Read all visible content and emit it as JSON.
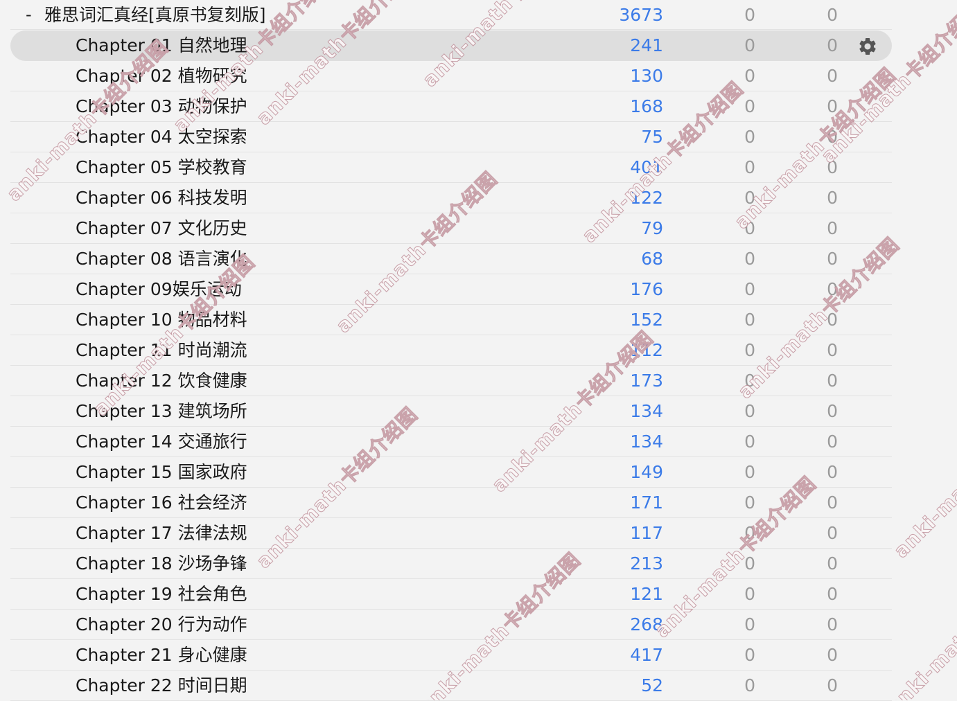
{
  "parent_deck": {
    "toggle": "-",
    "name": "雅思词汇真经[真原书复刻版]",
    "new": "3673",
    "learn": "0",
    "due": "0"
  },
  "decks": [
    {
      "name": "Chapter 01 自然地理",
      "new": "241",
      "learn": "0",
      "due": "0"
    },
    {
      "name": "Chapter 02 植物研究",
      "new": "130",
      "learn": "0",
      "due": "0"
    },
    {
      "name": "Chapter 03 动物保护",
      "new": "168",
      "learn": "0",
      "due": "0"
    },
    {
      "name": "Chapter 04 太空探索",
      "new": "75",
      "learn": "0",
      "due": "0"
    },
    {
      "name": "Chapter 05 学校教育",
      "new": "401",
      "learn": "0",
      "due": "0"
    },
    {
      "name": "Chapter 06 科技发明",
      "new": "122",
      "learn": "0",
      "due": "0"
    },
    {
      "name": "Chapter 07 文化历史",
      "new": "79",
      "learn": "0",
      "due": "0"
    },
    {
      "name": "Chapter 08 语言演化",
      "new": "68",
      "learn": "0",
      "due": "0"
    },
    {
      "name": "Chapter 09娱乐运动",
      "new": "176",
      "learn": "0",
      "due": "0"
    },
    {
      "name": "Chapter 10 物品材料",
      "new": "152",
      "learn": "0",
      "due": "0"
    },
    {
      "name": "Chapter 11 时尚潮流",
      "new": "112",
      "learn": "0",
      "due": "0"
    },
    {
      "name": "Chapter 12 饮食健康",
      "new": "173",
      "learn": "0",
      "due": "0"
    },
    {
      "name": "Chapter 13 建筑场所",
      "new": "134",
      "learn": "0",
      "due": "0"
    },
    {
      "name": "Chapter 14 交通旅行",
      "new": "134",
      "learn": "0",
      "due": "0"
    },
    {
      "name": "Chapter 15 国家政府",
      "new": "149",
      "learn": "0",
      "due": "0"
    },
    {
      "name": "Chapter 16 社会经济",
      "new": "171",
      "learn": "0",
      "due": "0"
    },
    {
      "name": "Chapter 17 法律法规",
      "new": "117",
      "learn": "0",
      "due": "0"
    },
    {
      "name": "Chapter 18 沙场争锋",
      "new": "213",
      "learn": "0",
      "due": "0"
    },
    {
      "name": "Chapter 19 社会角色",
      "new": "121",
      "learn": "0",
      "due": "0"
    },
    {
      "name": "Chapter 20 行为动作",
      "new": "268",
      "learn": "0",
      "due": "0"
    },
    {
      "name": "Chapter 21 身心健康",
      "new": "417",
      "learn": "0",
      "due": "0"
    },
    {
      "name": "Chapter 22 时间日期",
      "new": "52",
      "learn": "0",
      "due": "0"
    }
  ],
  "selected_index": 0,
  "gear_icon": "gear-icon",
  "watermark_text": "anki-math卡组介绍图",
  "colors": {
    "new_count": "#3b7be8",
    "zero_count": "#9a9a9a",
    "selected_row": "#dedede",
    "background": "#f3f3f3"
  }
}
